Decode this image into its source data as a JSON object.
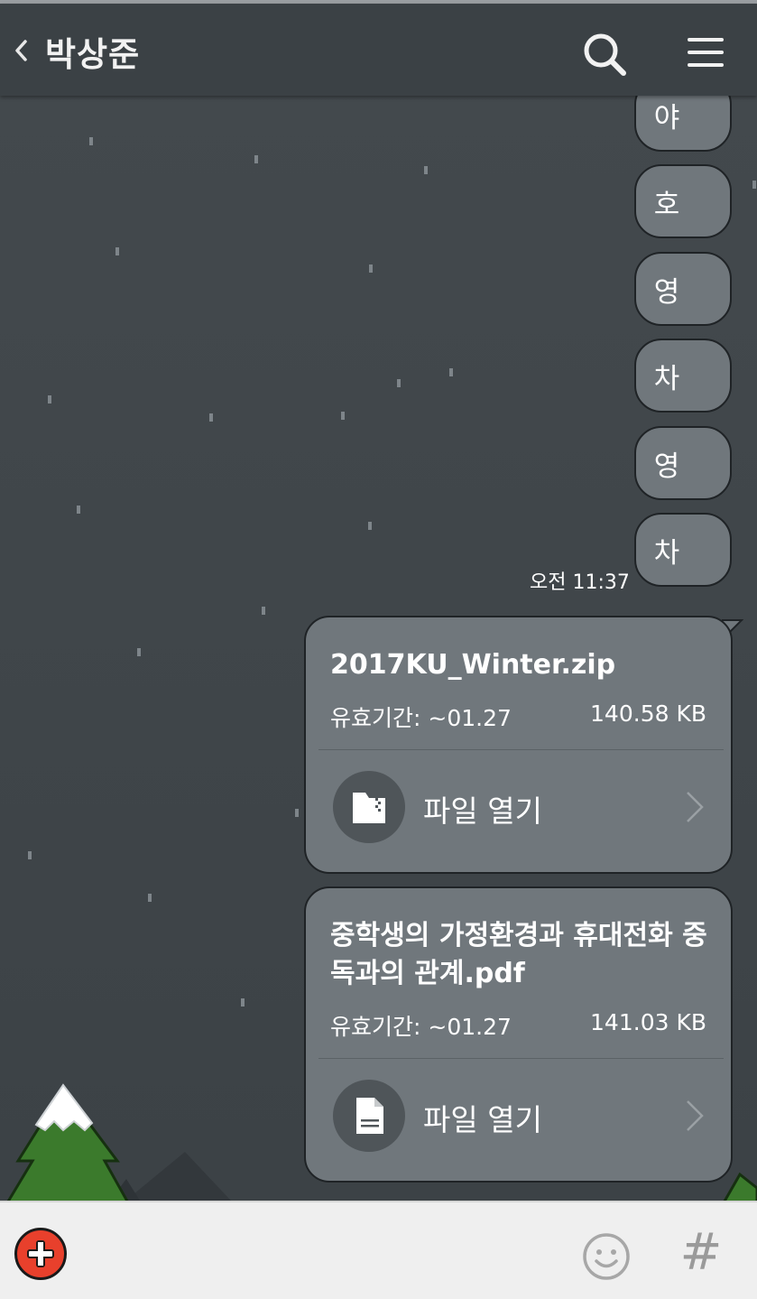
{
  "header": {
    "title": "박상준",
    "back_icon": "chevron-left-icon",
    "search_icon": "search-icon",
    "menu_icon": "hamburger-menu-icon"
  },
  "messages": [
    {
      "text": "야"
    },
    {
      "text": "호"
    },
    {
      "text": "영"
    },
    {
      "text": "차"
    },
    {
      "text": "영"
    },
    {
      "text": "차"
    }
  ],
  "timestamp": "오전 11:37",
  "files": [
    {
      "name": "2017KU_Winter.zip",
      "expiry": "유효기간: ~01.27",
      "size": "140.58 KB",
      "open_label": "파일 열기",
      "icon": "zip-folder-icon"
    },
    {
      "name": "중학생의 가정환경과 휴대전화 중독과의 관계.pdf",
      "expiry": "유효기간: ~01.27",
      "size": "141.03 KB",
      "open_label": "파일 열기",
      "icon": "document-icon"
    }
  ],
  "bottom_bar": {
    "plus_icon": "plus-icon",
    "emoji_icon": "emoji-icon",
    "hash_label": "#"
  },
  "colors": {
    "background": "#3f4549",
    "bubble": "#70777c",
    "plus_button": "#e8402c"
  }
}
